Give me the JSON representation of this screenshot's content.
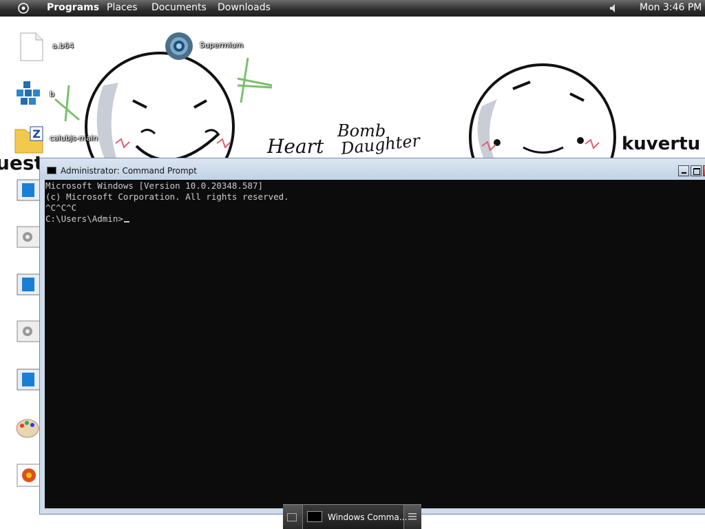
{
  "topbar": {
    "menu_items": [
      "Programs",
      "Places",
      "Documents",
      "Downloads"
    ],
    "clock": "Mon 3:46 PM"
  },
  "wallpaper": {
    "word_heart": "Heart",
    "word_bomb": "Bomb",
    "word_daughter": "Daughter",
    "word_kuvertu": "kuvertu",
    "word_left": "uest"
  },
  "desktop_icons": [
    {
      "label": "a.b64",
      "icon": "file-icon"
    },
    {
      "label": "b",
      "icon": "blocks-icon"
    },
    {
      "label": "calubjs-main",
      "icon": "zip-folder-icon"
    },
    {
      "label": "Supermium",
      "icon": "browser-icon"
    }
  ],
  "cmd_window": {
    "title": "Administrator: Command Prompt",
    "lines": [
      "Microsoft Windows [Version 10.0.20348.587]",
      "(c) Microsoft Corporation. All rights reserved.",
      "^C^C^C",
      "C:\\Users\\Admin>"
    ]
  },
  "taskbar": {
    "task_label": "Windows Comma..."
  },
  "colors": {
    "console_bg": "#0c0c0c",
    "console_fg": "#cccccc",
    "topbar_bg": "#2e2e2e",
    "window_frame": "#cfdcea"
  }
}
